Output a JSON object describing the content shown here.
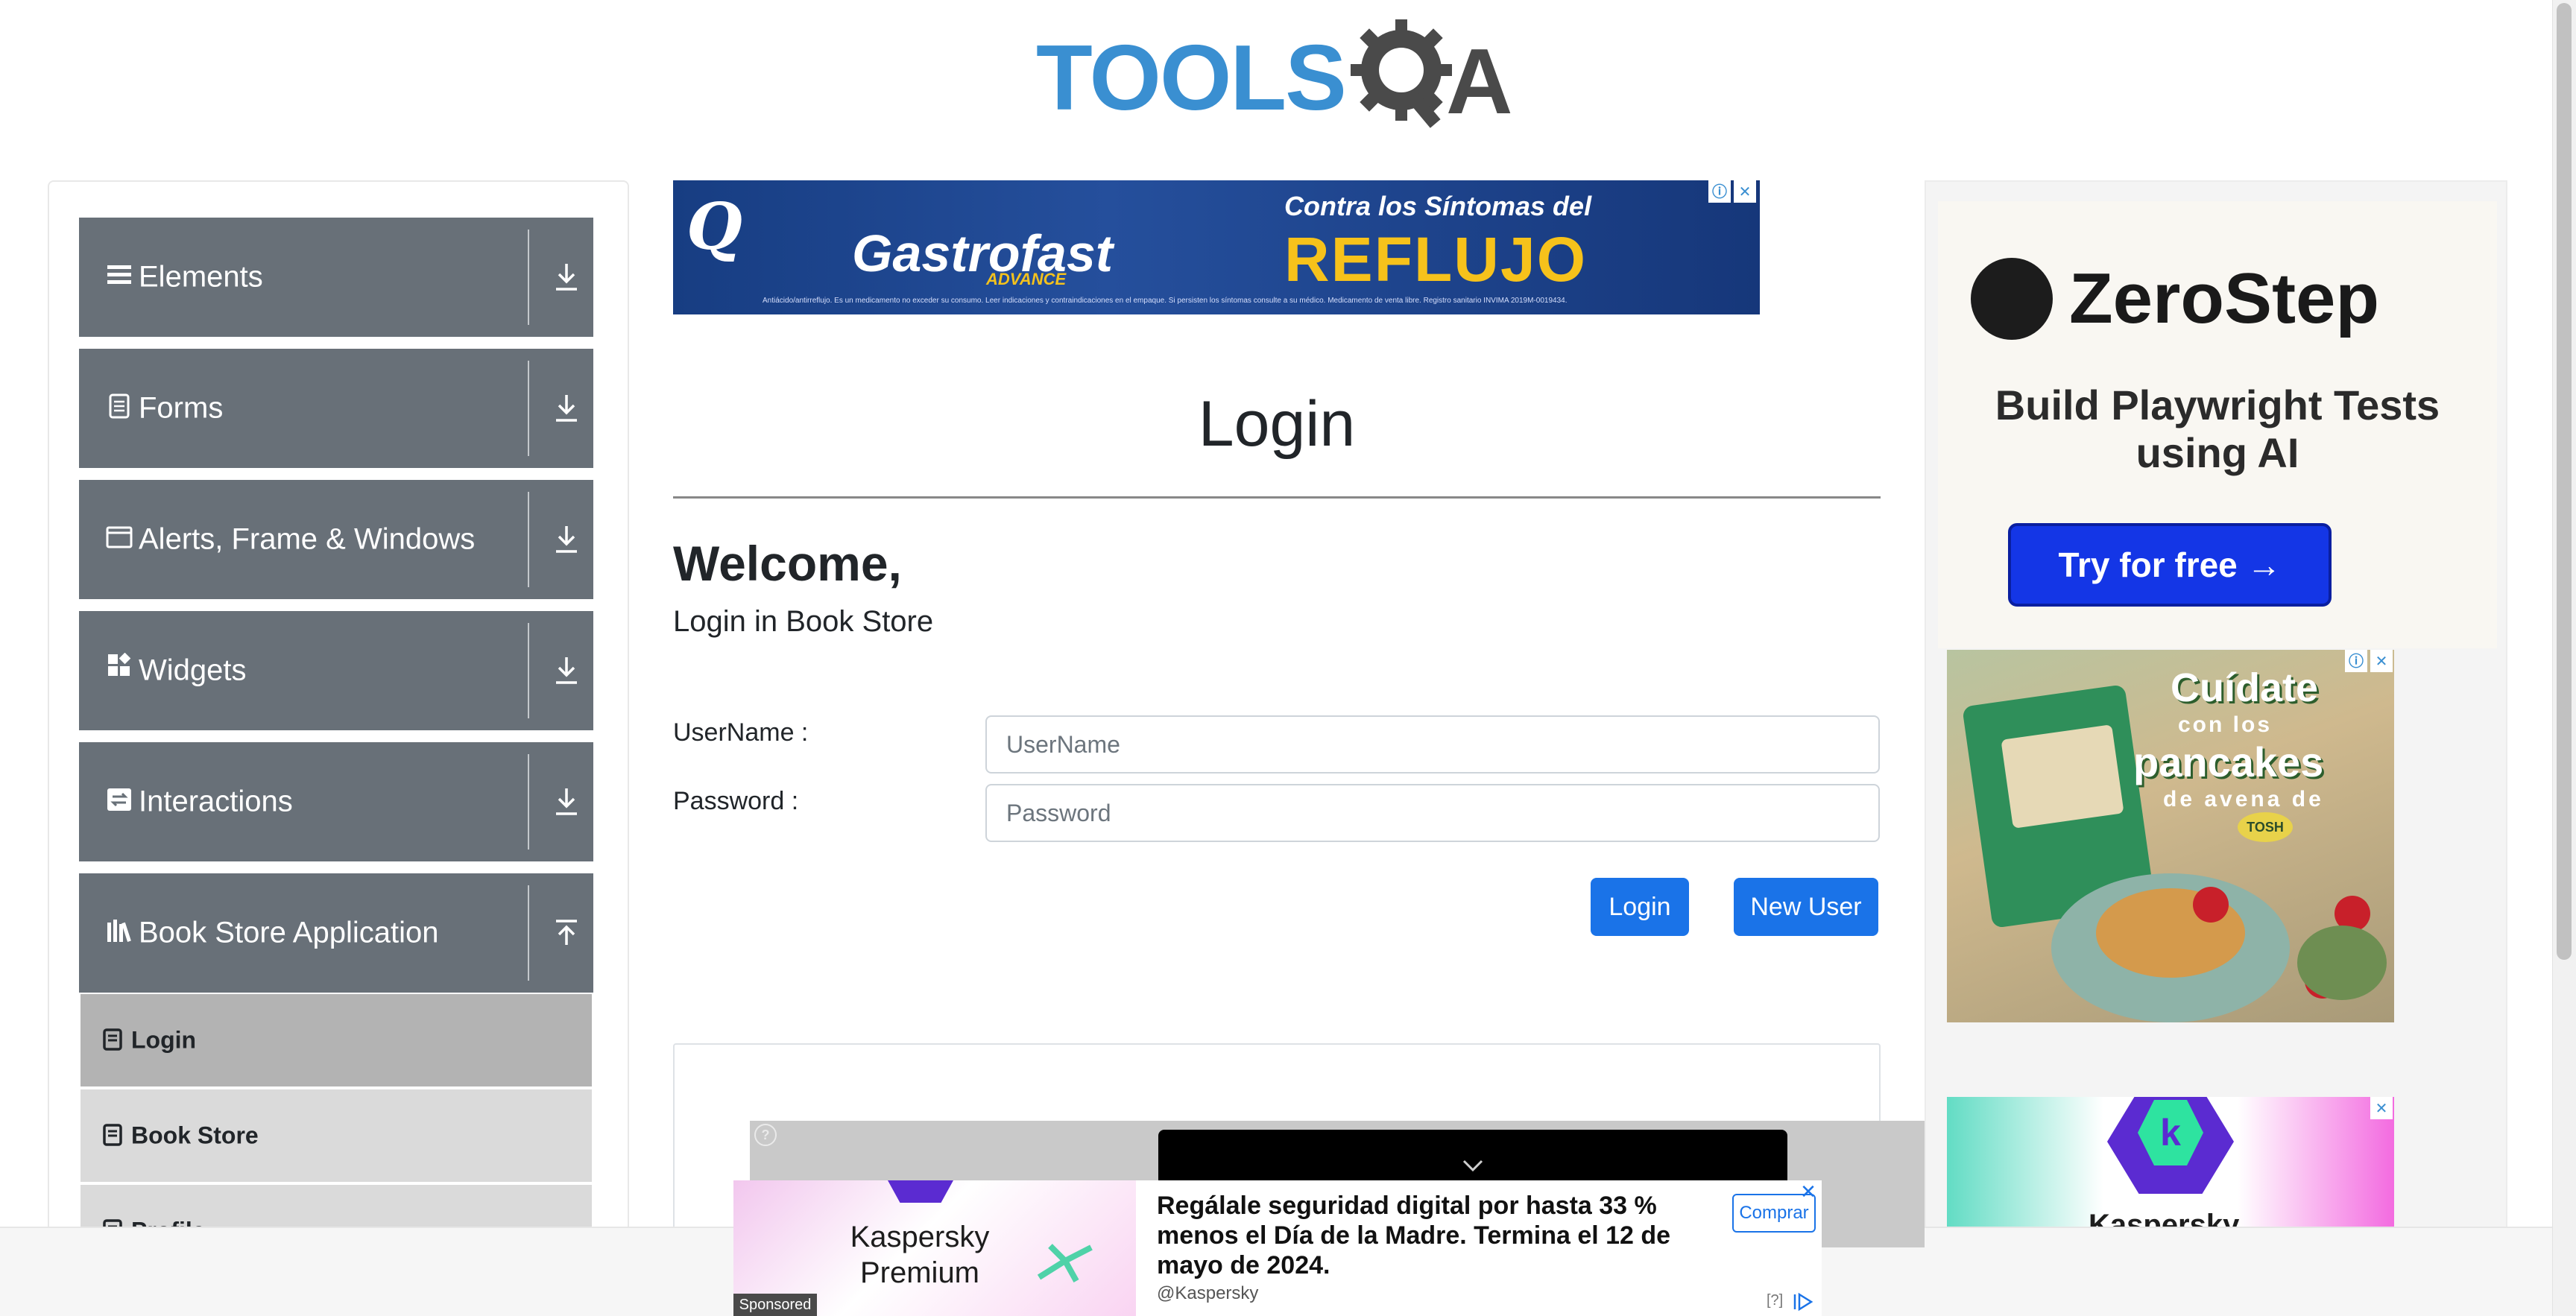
{
  "header": {
    "logo_tools": "TOOLS",
    "logo_qa": "A"
  },
  "sidebar": {
    "groups": [
      {
        "label": "Elements",
        "icon": "menu-icon",
        "arrow": "download-arrow-icon"
      },
      {
        "label": "Forms",
        "icon": "document-icon",
        "arrow": "download-arrow-icon"
      },
      {
        "label": "Alerts, Frame & Windows",
        "icon": "window-icon",
        "arrow": "download-arrow-icon"
      },
      {
        "label": "Widgets",
        "icon": "widgets-icon",
        "arrow": "download-arrow-icon"
      },
      {
        "label": "Interactions",
        "icon": "interaction-icon",
        "arrow": "download-arrow-icon"
      },
      {
        "label": "Book Store Application",
        "icon": "books-icon",
        "arrow": "upload-arrow-icon"
      }
    ],
    "subitems": [
      {
        "label": "Login",
        "active": true
      },
      {
        "label": "Book Store",
        "active": false
      },
      {
        "label": "Profile",
        "active": false
      }
    ]
  },
  "top_ad": {
    "brand": "Gastrofast",
    "brand_sub": "ADVANCE",
    "headline": "Contra los Síntomas del",
    "headline_big": "REFLUJO",
    "fine_print": "Antiácido/antirreflujo. Es un medicamento no exceder su consumo. Leer indicaciones y contraindicaciones en el empaque. Si persisten los síntomas consulte a su médico. Medicamento de venta libre. Registro sanitario INVIMA 2019M-0019434."
  },
  "main": {
    "title": "Login",
    "welcome": "Welcome,",
    "subtitle": "Login in Book Store",
    "username_label": "UserName :",
    "username_placeholder": "UserName",
    "password_label": "Password :",
    "password_placeholder": "Password",
    "login_button": "Login",
    "new_user_button": "New User"
  },
  "right_ads": {
    "zerostep_name": "ZeroStep",
    "zerostep_tagline": "Build Playwright Tests using AI",
    "zerostep_button": "Try for free →",
    "food_line1": "Cuídate",
    "food_line2": "con los",
    "food_line3": "pancakes",
    "food_line4": "de avena de",
    "food_brand": "TOSH",
    "kaspersky_letter": "k",
    "kaspersky_name": "Kaspersky"
  },
  "bottom_ad": {
    "product": "Kaspersky Premium",
    "message": "Regálale seguridad digital por hasta 33 % menos el Día de la Madre. Termina el 12 de mayo de 2024.",
    "handle": "@Kaspersky",
    "buy_button": "Comprar",
    "help": "[?]",
    "sponsored": "Sponsored",
    "video_help": "?"
  },
  "colors": {
    "sidebar_group": "#687078",
    "sidebar_active": "#b3b3b3",
    "primary_button": "#1a73e8",
    "logo_blue": "#3a8fd1",
    "logo_gray": "#4a4a4a"
  }
}
